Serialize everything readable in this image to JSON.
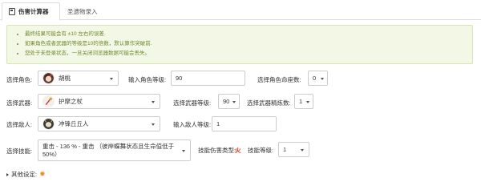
{
  "tabs": [
    {
      "label": "伤害计算器",
      "active": true,
      "icon": "calculator-icon"
    },
    {
      "label": "圣遗物录入",
      "active": false
    }
  ],
  "notice": {
    "lines": [
      "最终结果可能会有 ±10 左右的误差.",
      "如果角色或者武器的等级是10的倍数，默认算作突破前.",
      "您处于未登录状态，一旦关闭浏览器数据可能会丢失。"
    ],
    "color": "#6f8a30"
  },
  "character": {
    "label": "选择角色:",
    "value": "胡桃",
    "level_label": "输入角色等级:",
    "level": "90",
    "constellation_label": "选择角色命座数:",
    "constellation": "0"
  },
  "weapon": {
    "label": "选择武器:",
    "value": "护摩之杖",
    "level_label": "选择武器等级:",
    "level": "90",
    "refine_label": "选择武器精炼数:",
    "refine": "1"
  },
  "enemy": {
    "label": "选择敌人:",
    "value": "冲锋丘丘人",
    "level_label": "输入敌人等级:",
    "level": "1"
  },
  "skill": {
    "label": "选择技能:",
    "value_line1": "重击 - 136 % - 重击 （彼岸蝶舞状态且生命值低于",
    "value_line2": "50%）",
    "type_label": "技能伤害类型:",
    "type_icon": "火",
    "level_label": "技能等级:",
    "level": "1"
  },
  "other": {
    "label": "其他设定:",
    "icon": "gear-icon"
  },
  "colors": {
    "fire": "#e03a1e",
    "gear": "#e8922c"
  }
}
